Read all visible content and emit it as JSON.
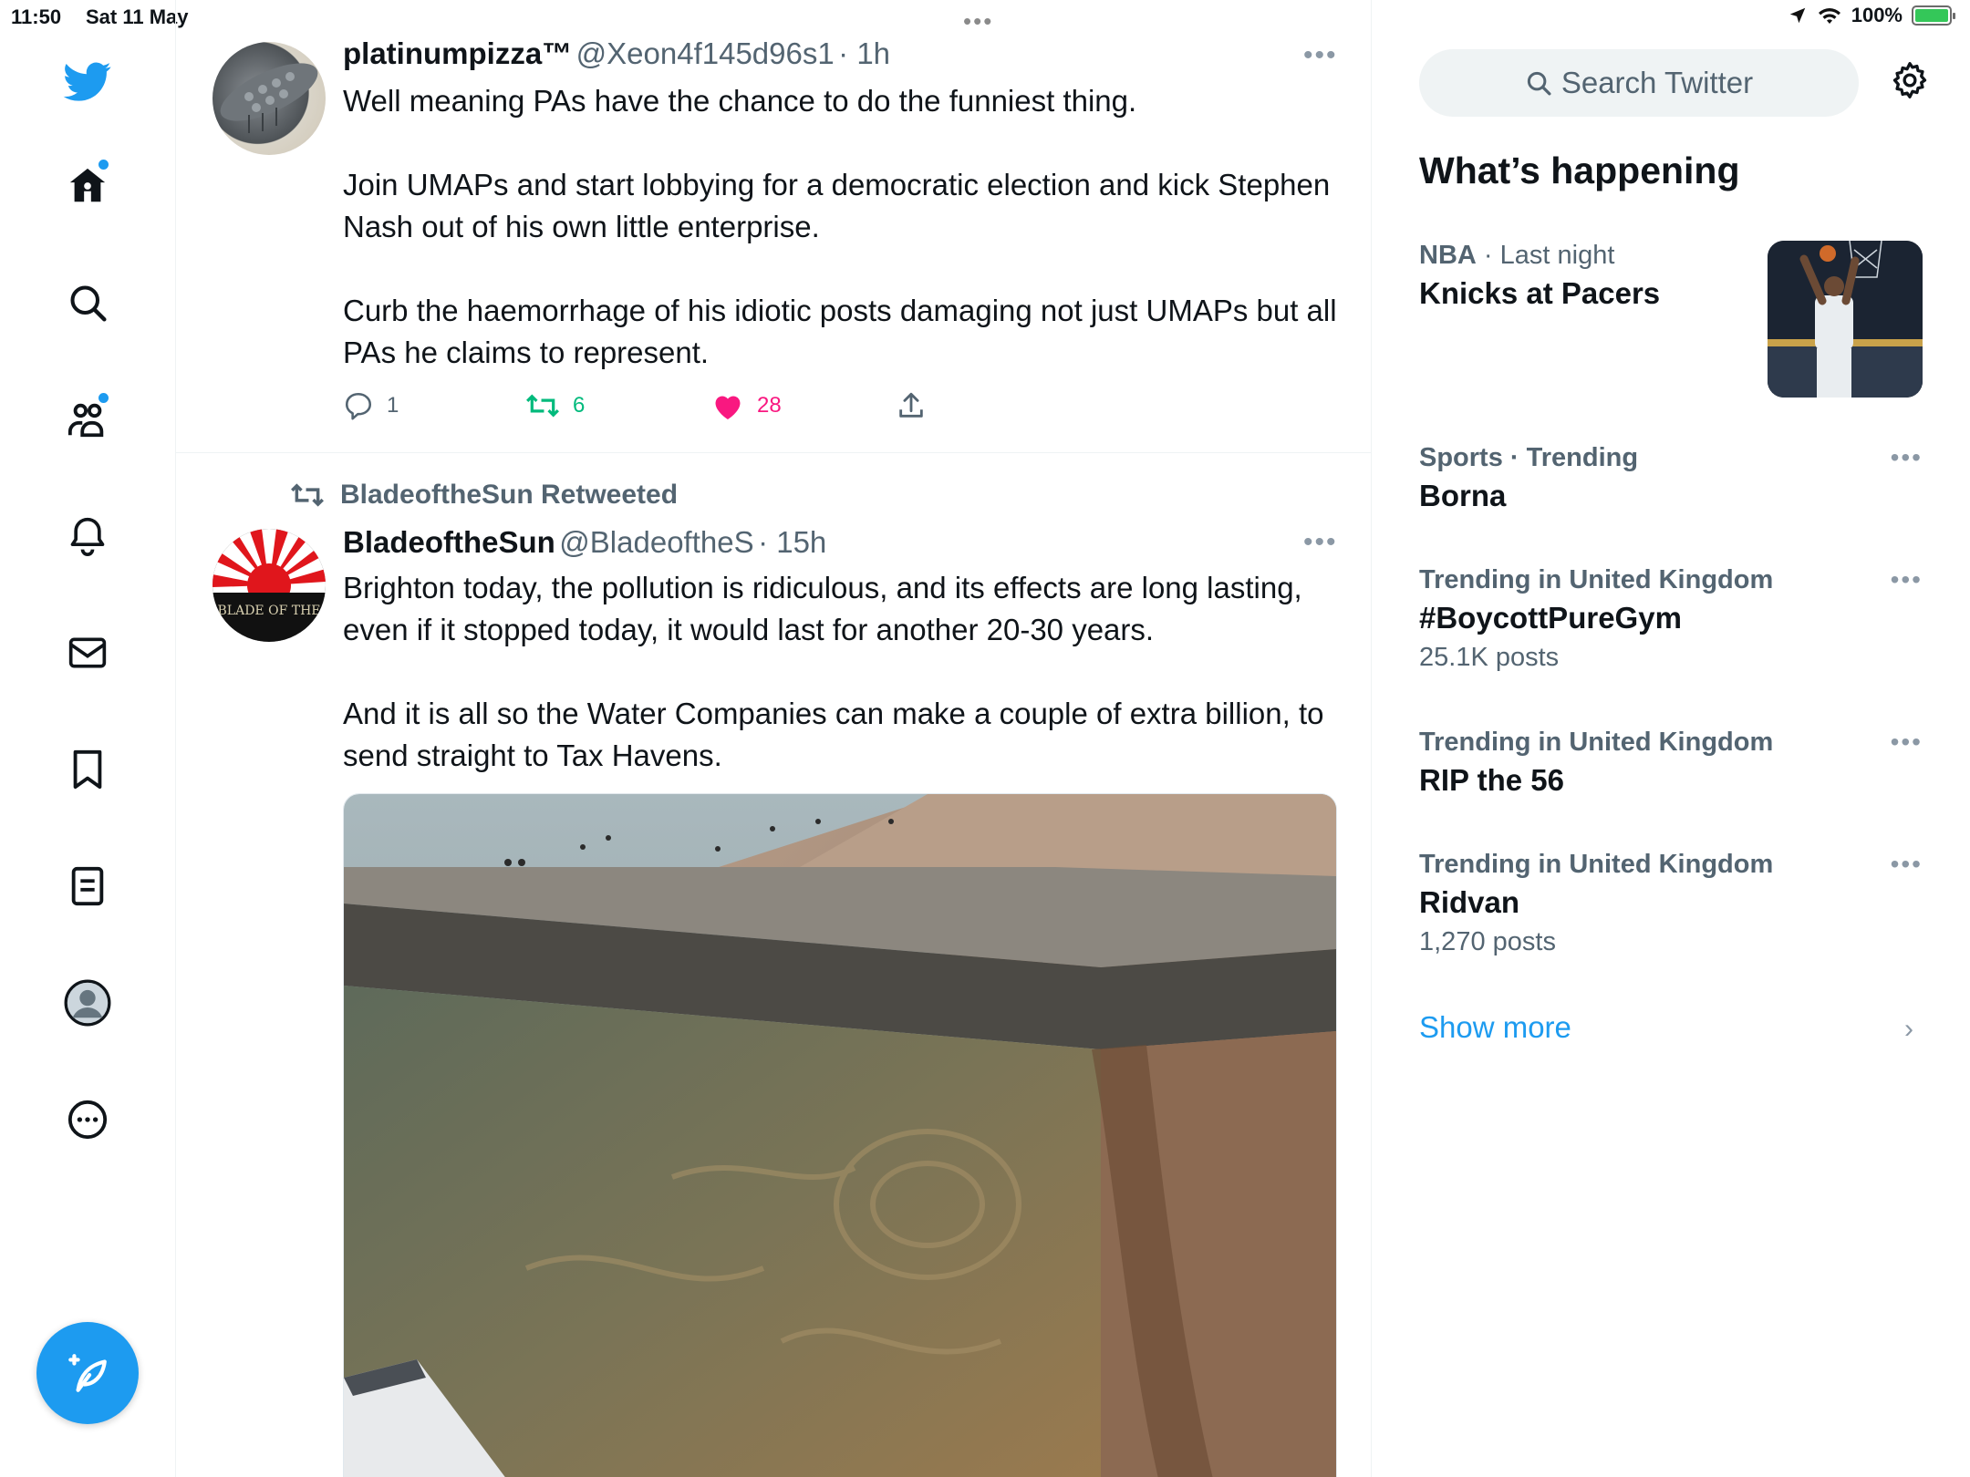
{
  "status_bar": {
    "time": "11:50",
    "date": "Sat 11 May",
    "battery": "100%",
    "battery_level": 1.0,
    "multitask_dots": "•••"
  },
  "nav": {
    "items": [
      {
        "name": "home",
        "notification": true
      },
      {
        "name": "explore",
        "notification": false
      },
      {
        "name": "communities",
        "notification": true
      },
      {
        "name": "notifications",
        "notification": false
      },
      {
        "name": "messages",
        "notification": false
      },
      {
        "name": "bookmarks",
        "notification": false
      },
      {
        "name": "lists",
        "notification": false
      },
      {
        "name": "profile",
        "notification": false
      },
      {
        "name": "more",
        "notification": false
      }
    ],
    "accent": "#1d9bf0"
  },
  "tweets": [
    {
      "name": "platinumpizza™",
      "handle": "@Xeon4f145d96s1",
      "time": "· 1h",
      "paragraphs": [
        "Well meaning PAs have the chance to do the funniest thing.",
        "Join UMAPs and start lobbying for a democratic election and kick Stephen Nash out of his own little enterprise.",
        "Curb the haemorrhage of his idiotic posts damaging not just UMAPs but all PAs he claims to represent."
      ],
      "replies": "1",
      "retweets": "6",
      "likes": "28",
      "retweeted_color": "#00ba7c",
      "liked_color": "#f91880"
    },
    {
      "retweeted_by": "BladeoftheSun Retweeted",
      "name": "BladeoftheSun",
      "handle": "@BladeoftheS",
      "time": "· 15h",
      "avatar_text": "BLADE OF THE",
      "paragraphs": [
        "Brighton today, the pollution is ridiculous, and its effects are long lasting, even if it stopped today, it would last for another 20-30 years.",
        "And it is all so the Water Companies can make a couple of extra billion, to send straight to Tax Havens."
      ]
    }
  ],
  "sidebar": {
    "search_placeholder": "Search Twitter",
    "whats_happening": "What’s happening",
    "trends": [
      {
        "category": "NBA",
        "context": "· Last night",
        "title": "Knicks at Pacers",
        "count": "",
        "has_image": true
      },
      {
        "category": "Sports · Trending",
        "context": "",
        "title": "Borna",
        "count": ""
      },
      {
        "category": "Trending in United Kingdom",
        "context": "",
        "title": "#BoycottPureGym",
        "count": "25.1K posts"
      },
      {
        "category": "Trending in United Kingdom",
        "context": "",
        "title": "RIP the 56",
        "count": ""
      },
      {
        "category": "Trending in United Kingdom",
        "context": "",
        "title": "Ridvan",
        "count": "1,270 posts"
      }
    ],
    "show_more": "Show more",
    "more_glyph": "•••",
    "chevron": "›"
  }
}
